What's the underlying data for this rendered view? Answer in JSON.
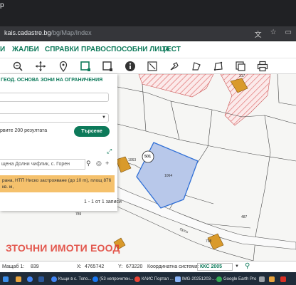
{
  "browser": {
    "tab_fragment": "p",
    "url_host": "kais.cadastre.bg",
    "url_path": "/bg/Map/Index"
  },
  "menu": [
    "И",
    "ЖАЛБИ",
    "СПРАВКИ",
    "ПРАВОСПОСОБНИ ЛИЦА",
    "ТЕСТ"
  ],
  "panel": {
    "tabs": [
      "ГЕОД. ОСНОВА",
      "ЗОНИ НА ОГРАНИЧЕНИЯ"
    ],
    "limit_text": "рвите 200 резултата",
    "search_button": "Търсене",
    "result_query": "щена Долни чифлик, с. Горен",
    "result_row": "рана, НТП Ниско застрояване (до 10 m), площ 876 кв. м,",
    "pager": "1 - 1 от 1 записи"
  },
  "parcels": {
    "p317": "317",
    "p1063": "1063",
    "p501": "501",
    "p1064": "1064",
    "p487": "487",
    "p789": "789",
    "p798": "798",
    "road": "Орты"
  },
  "watermark": "ЗТОЧНИ ИМОТИ ЕООД",
  "status": {
    "scale_label": "Мащаб 1:",
    "scale_value": "839",
    "x_label": "X:",
    "x_value": "4765742",
    "y_label": "Y:",
    "y_value": "673220",
    "crs_label": "Координатна система:",
    "crs_value": "ККС 2005"
  },
  "taskbar": [
    "Къщи в с. Топо...",
    "(53 непрочетен...",
    "КАИС Портал ...",
    "IMG-20251203-...",
    "Google Earth Pro"
  ],
  "colors": {
    "brand": "#0d7a5a",
    "selected_parcel": "#b8c8ea",
    "highlight_row": "#f5c16c",
    "watermark": "#e03c31"
  }
}
